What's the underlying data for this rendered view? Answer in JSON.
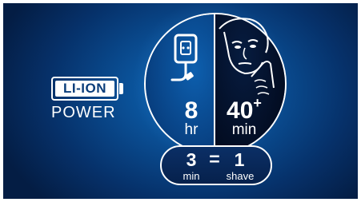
{
  "battery": {
    "label": "LI-ION",
    "subtitle": "POWER"
  },
  "charge": {
    "value": "8",
    "unit": "hr"
  },
  "shave_time": {
    "value": "40",
    "suffix": "+",
    "unit": "min"
  },
  "quick_charge": {
    "left_value": "3",
    "left_unit": "min",
    "equals": "=",
    "right_value": "1",
    "right_unit": "shave"
  },
  "icons": {
    "left": "power-plug-icon",
    "right": "shaving-man-icon"
  },
  "colors": {
    "background": "#0a4f95",
    "accent": "#ffffff"
  }
}
